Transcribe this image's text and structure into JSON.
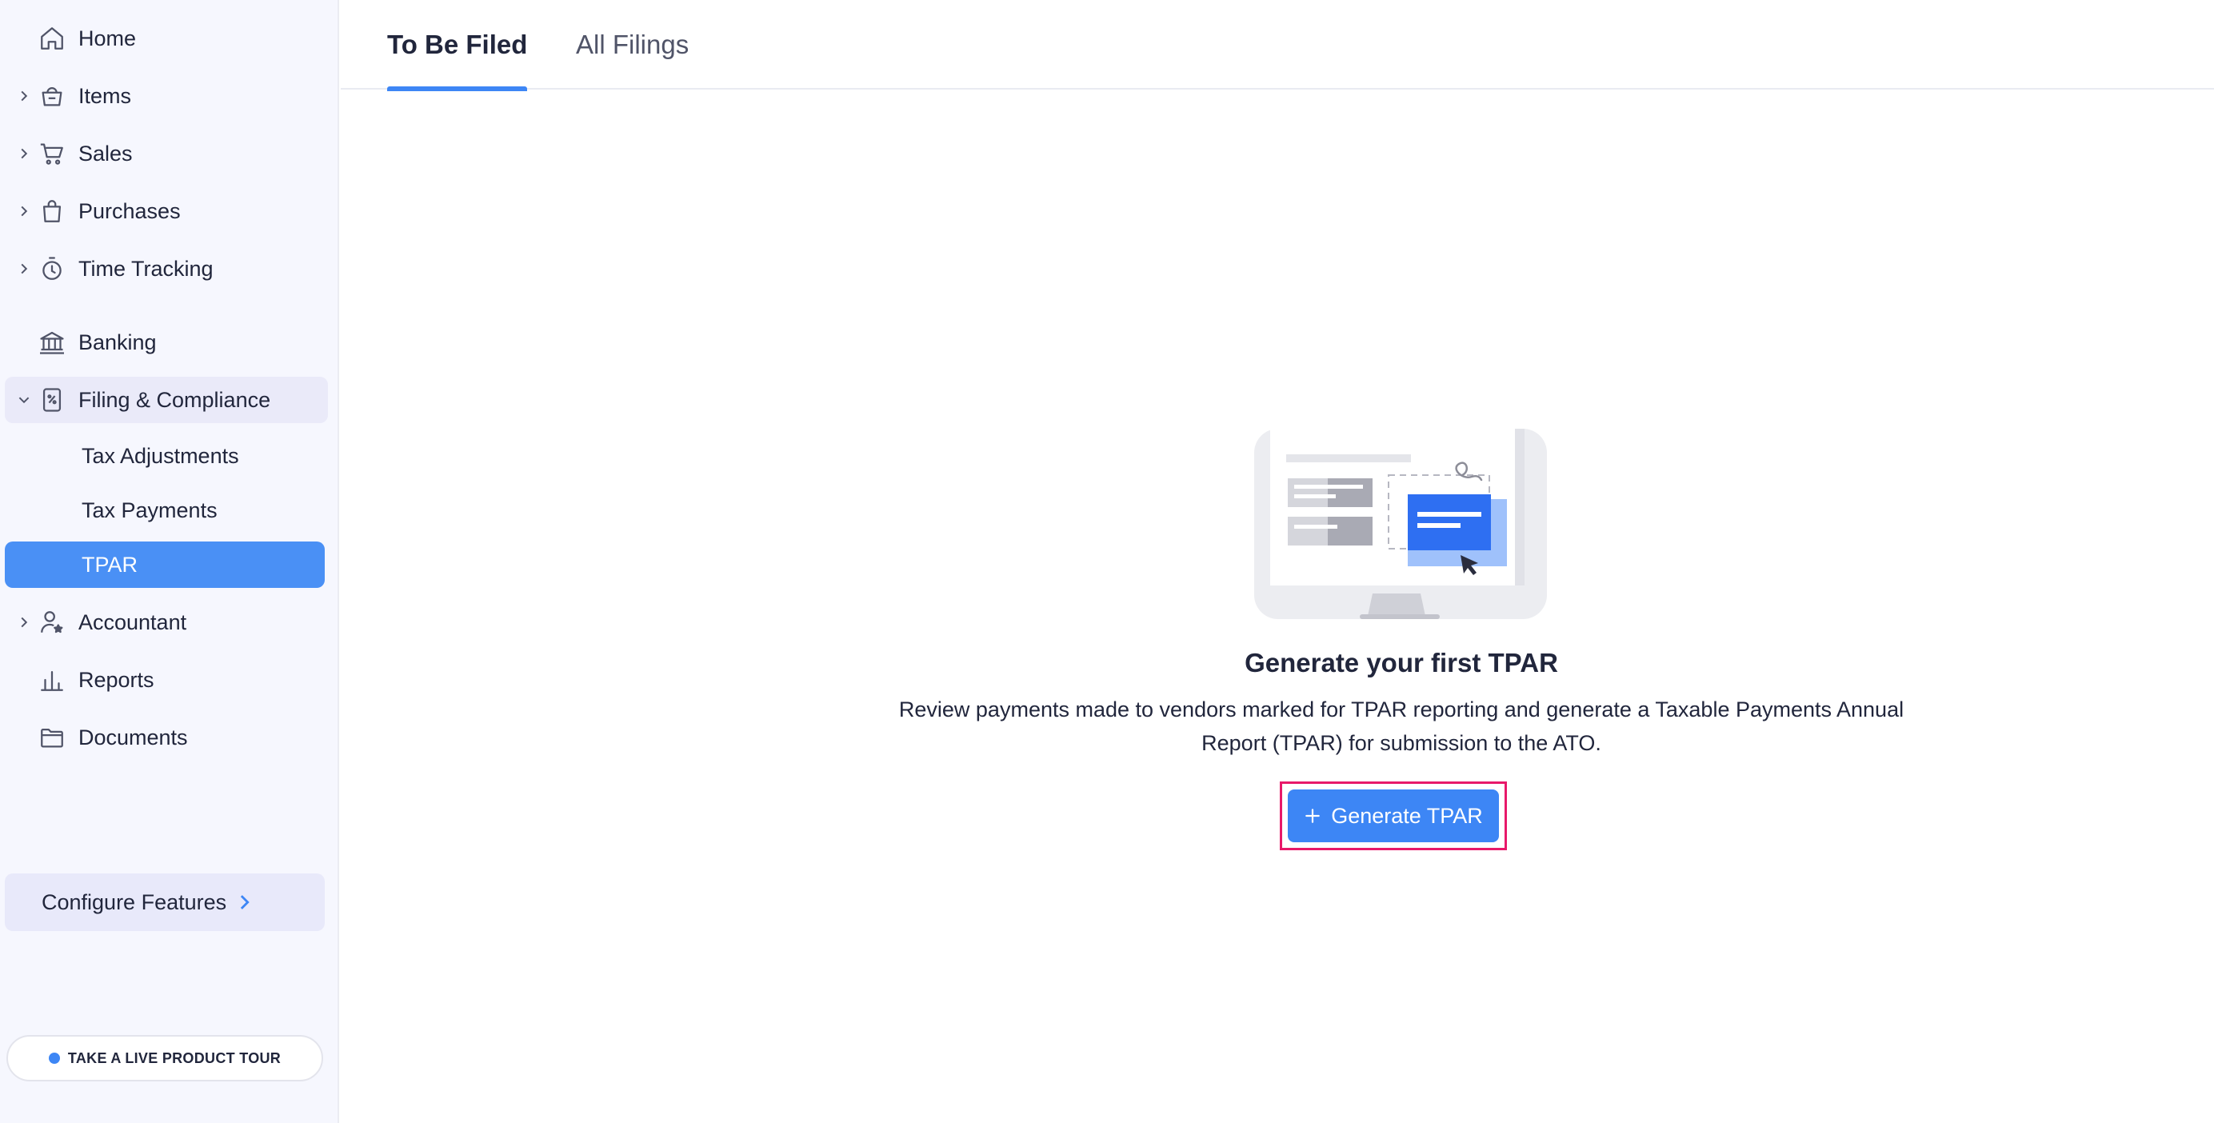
{
  "sidebar": {
    "items": [
      {
        "label": "Home",
        "icon": "home-icon"
      },
      {
        "label": "Items",
        "icon": "basket-icon"
      },
      {
        "label": "Sales",
        "icon": "cart-icon"
      },
      {
        "label": "Purchases",
        "icon": "shopping-bag-icon"
      },
      {
        "label": "Time Tracking",
        "icon": "stopwatch-icon"
      },
      {
        "label": "Banking",
        "icon": "bank-icon"
      },
      {
        "label": "Filing & Compliance",
        "icon": "tax-document-icon"
      },
      {
        "label": "Accountant",
        "icon": "user-star-icon"
      },
      {
        "label": "Reports",
        "icon": "bar-chart-icon"
      },
      {
        "label": "Documents",
        "icon": "folder-icon"
      }
    ],
    "sub_items": [
      {
        "label": "Tax Adjustments"
      },
      {
        "label": "Tax Payments"
      },
      {
        "label": "TPAR",
        "selected": true
      }
    ],
    "configure_label": "Configure Features",
    "tour_label": "TAKE A LIVE PRODUCT TOUR"
  },
  "tabs": [
    {
      "label": "To Be Filed",
      "active": true
    },
    {
      "label": "All Filings",
      "active": false
    }
  ],
  "empty_state": {
    "title": "Generate your first TPAR",
    "description": "Review payments made to vendors marked for TPAR reporting and generate a Taxable Payments Annual Report (TPAR) for submission to the ATO.",
    "button_label": "Generate TPAR"
  },
  "colors": {
    "accent": "#3d86f5",
    "sidebar_bg": "#f6f7fe",
    "highlight": "#e8196a"
  }
}
